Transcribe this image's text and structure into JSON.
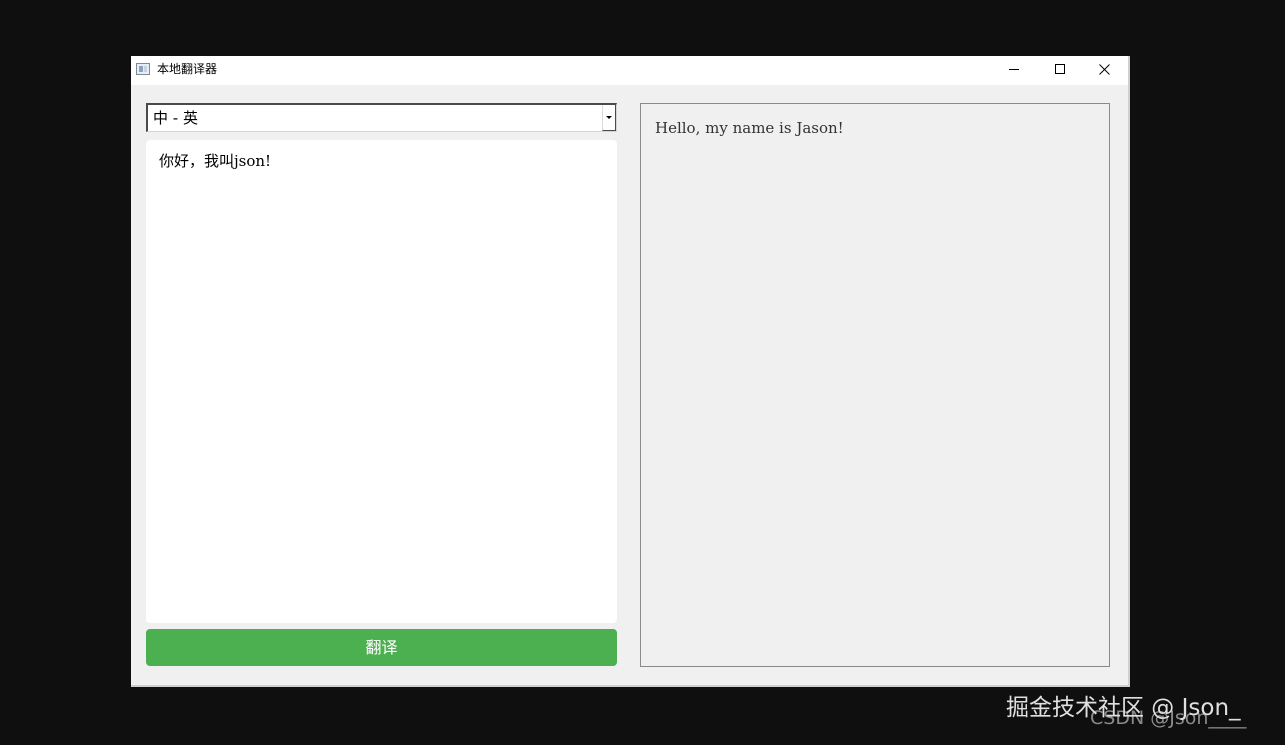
{
  "window": {
    "title": "本地翻译器",
    "icon": "app-window-icon",
    "controls": {
      "minimize": "minimize-icon",
      "maximize": "maximize-icon",
      "close": "close-icon"
    }
  },
  "language_select": {
    "value": "中 - 英",
    "arrow_icon": "chevron-down-icon"
  },
  "source": {
    "text": "你好，我叫json!"
  },
  "translate_button": {
    "label": "翻译",
    "color": "#4caf50"
  },
  "output": {
    "text": "Hello, my name is Jason!"
  },
  "watermark": {
    "primary": "掘金技术社区 @ Json_",
    "secondary": "CSDN @Json____"
  }
}
